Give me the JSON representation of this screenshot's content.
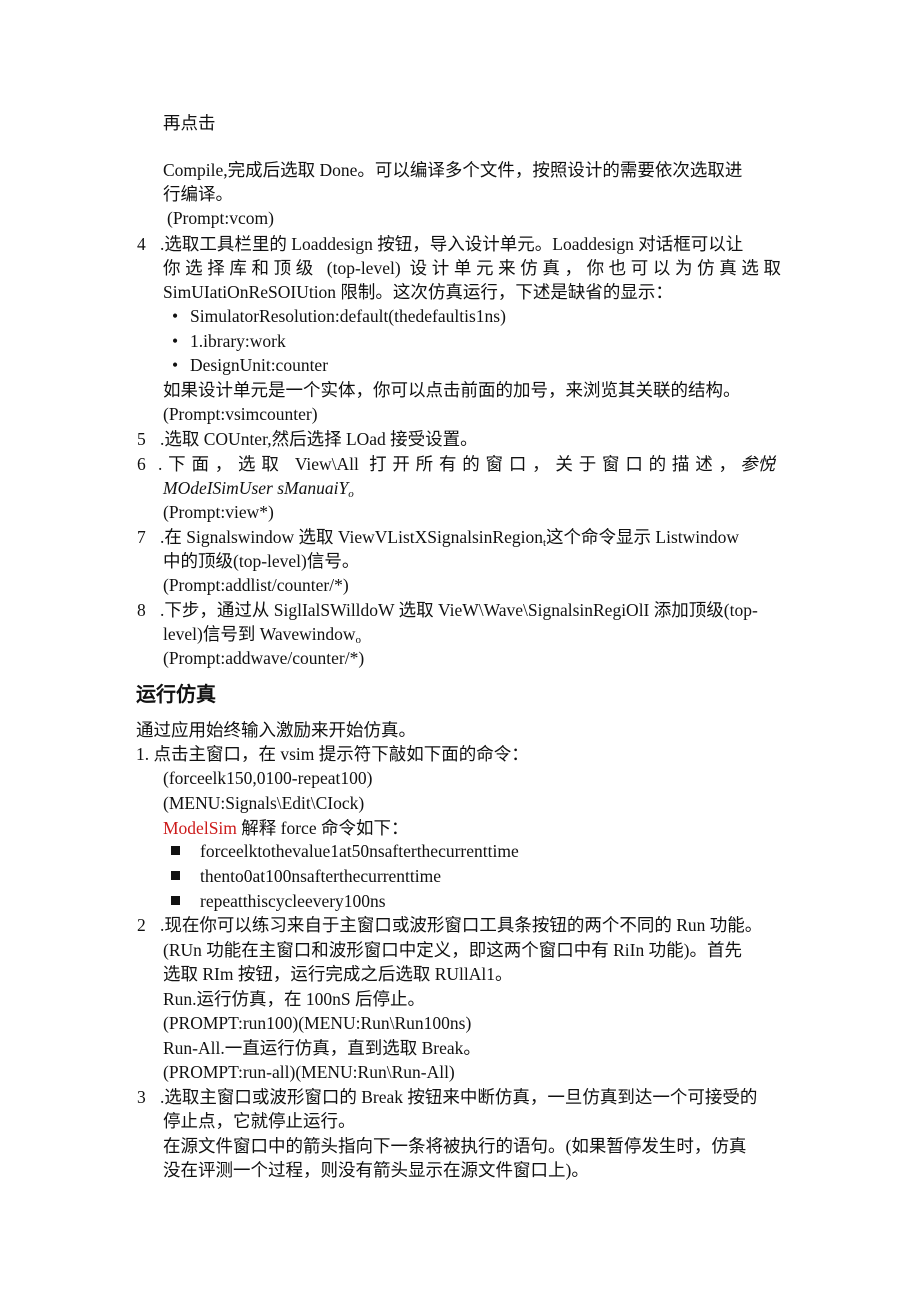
{
  "intro": {
    "line1": "再点击",
    "line2": "Compile,完成后选取 Done。可以编译多个文件，按照设计的需要依次选取进",
    "line3": "行编译。",
    "prompt": "(Prompt:vcom)"
  },
  "steps_load": [
    {
      "num": "4",
      "lines": [
        ".选取工具栏里的 Loaddesign 按钮，导入设计单元。Loaddesign 对话框可以让",
        "你选择库和顶级 (top-level) 设计单元来仿真，你也可以为仿真选取",
        "SimUIatiOnReSOIUtion 限制。这次仿真运行，下述是缺省的显示："
      ],
      "bullets": [
        "SimulatorResolution:default(thedefaultis1ns)",
        "1.ibrary:work",
        "DesignUnit:counter"
      ],
      "after": "如果设计单元是一个实体，你可以点击前面的加号，来浏览其关联的结构。",
      "prompt": "(Prompt:vsimcounter)"
    },
    {
      "num": "5",
      "lines": [
        ".选取 COUnter,然后选择 LOad 接受设置。"
      ]
    },
    {
      "num": "6",
      "lines": [
        ".下面，选取 View\\All 打开所有的窗口，关于窗口的描述，"
      ],
      "italic_tail": "参悦",
      "italic_line": "MOdeISimUser sManuaiY",
      "italic_sub": "o",
      "prompt": "(Prompt:view*)"
    },
    {
      "num": "7",
      "line_a": ".在 Signalswindow 选取 ViewVListXSignalsinRegion",
      "line_a_sub": "t",
      "line_a_tail": "这个命令显示 Listwindow",
      "line_b": "中的顶级(top-level)信号。",
      "prompt": "(Prompt:addlist/counter/*)"
    },
    {
      "num": "8",
      "line_a": ".下步，通过从 SiglIalSWilldoW 选取 VieW\\Wave\\SignalsinRegiOlI 添加顶级(top-",
      "line_b": "level)信号到 Wavewindow",
      "line_b_sub": "o",
      "prompt": "(Prompt:addwave/counter/*)"
    }
  ],
  "section": {
    "heading": "运行仿真",
    "intro": "通过应用始终输入激励来开始仿真。",
    "step1": {
      "label": "1. 点击主窗口，在 vsim 提示符下敲如下面的命令：",
      "cmd1": "(forceelk150,0100-repeat100)",
      "cmd2": "(MENU:Signals\\Edit\\CIock)",
      "modelsim": "ModelSim",
      "explain": " 解释 force 命令如下：",
      "bullets": [
        "forceelktothevalue1at50nsafterthecurrenttime",
        "thento0at100nsafterthecurrenttime",
        "repeatthiscycleevery100ns"
      ]
    },
    "step2": {
      "num": "2",
      "lines": [
        ".现在你可以练习来自于主窗口或波形窗口工具条按钮的两个不同的 Run 功能。",
        "(RUn 功能在主窗口和波形窗口中定义，即这两个窗口中有 RiIn 功能)。首先",
        "选取 RIm 按钮，运行完成之后选取 RUllAl1。",
        "Run.运行仿真，在 100nS 后停止。",
        "(PROMPT:run100)(MENU:Run\\Run100ns)",
        "Run-All.一直运行仿真，直到选取 Break。",
        "(PROMPT:run-all)(MENU:Run\\Run-All)"
      ]
    },
    "step3": {
      "num": "3",
      "lines": [
        ".选取主窗口或波形窗口的 Break 按钮来中断仿真，一旦仿真到达一个可接受的",
        "停止点，它就停止运行。",
        "在源文件窗口中的箭头指向下一条将被执行的语句。(如果暂停发生时，仿真",
        "没在评测一个过程，则没有箭头显示在源文件窗口上)。"
      ]
    }
  },
  "colors": {
    "text": "#111111",
    "accent_red": "#cc1a1a"
  }
}
